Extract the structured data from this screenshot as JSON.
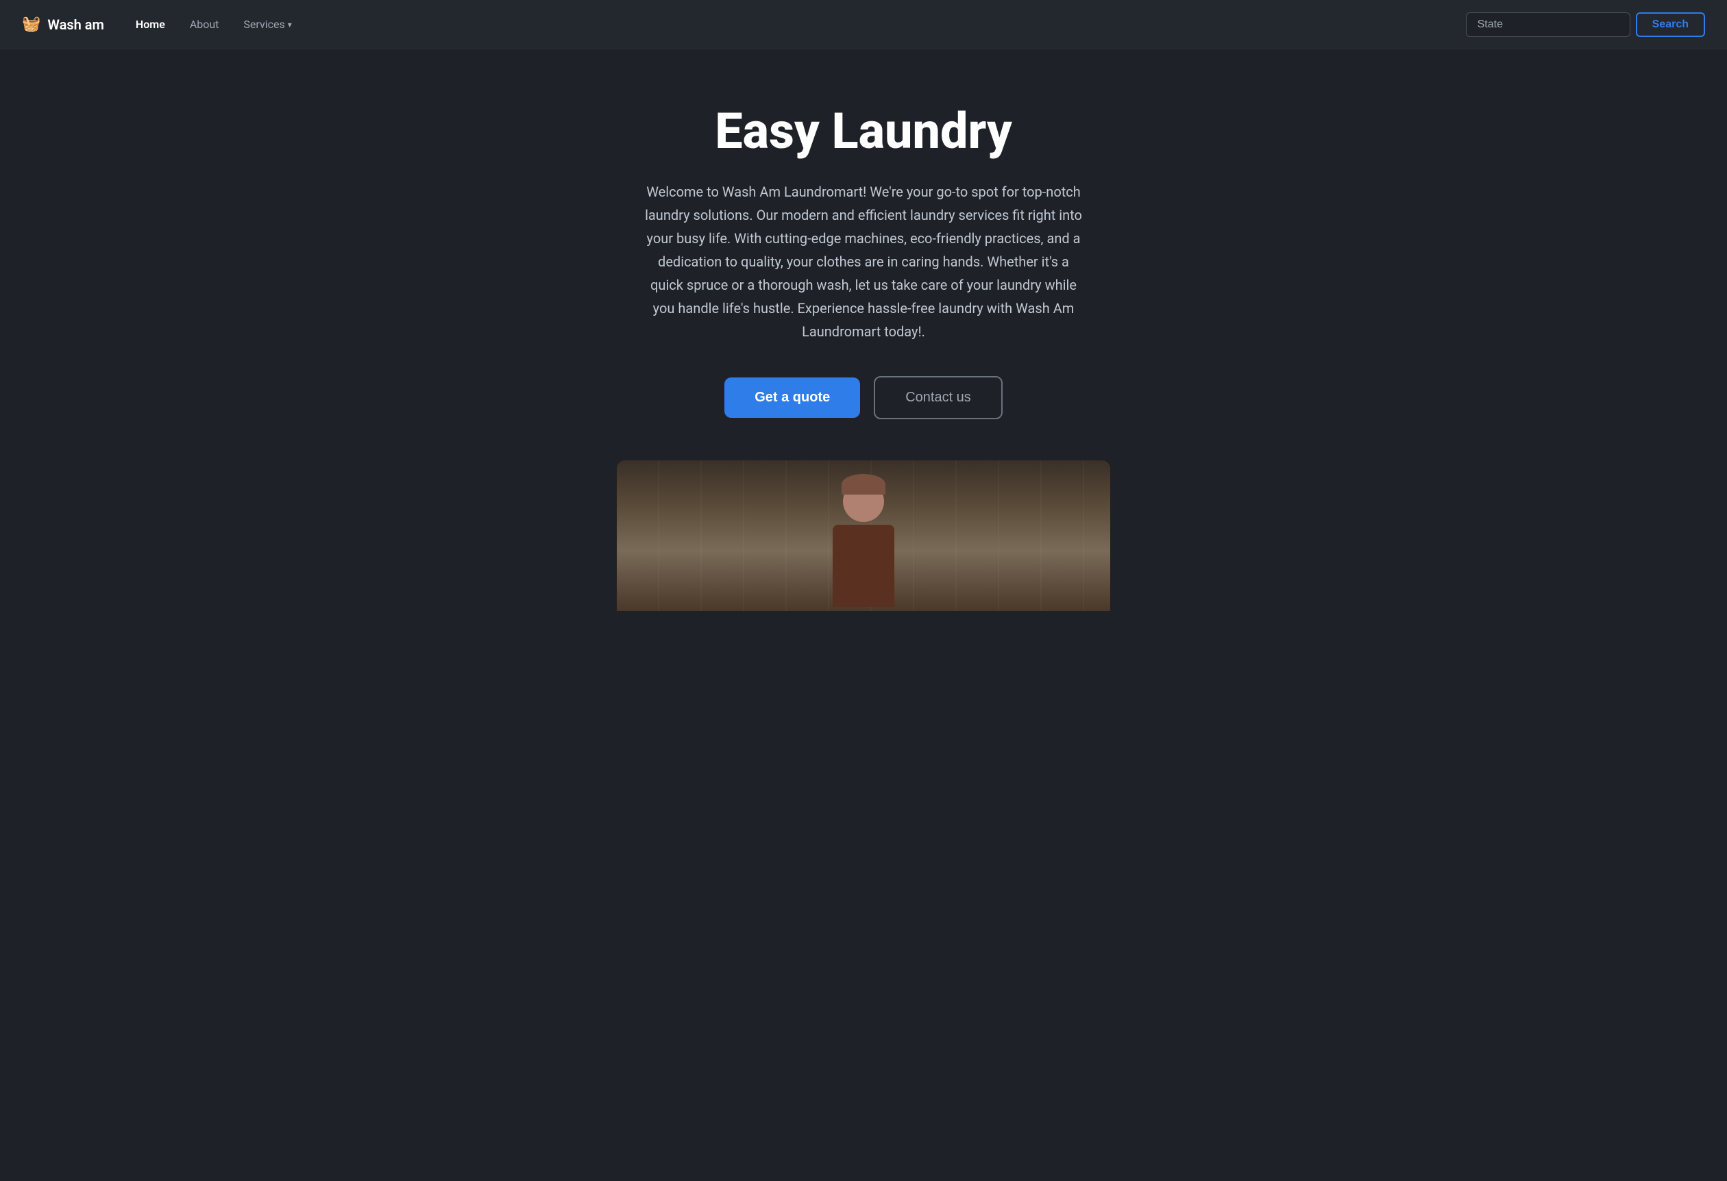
{
  "nav": {
    "brand_icon": "🧺",
    "brand_name": "Wash am",
    "links": [
      {
        "label": "Home",
        "active": true
      },
      {
        "label": "About",
        "active": false
      },
      {
        "label": "Services",
        "has_dropdown": true,
        "active": false
      }
    ],
    "search": {
      "placeholder": "State",
      "button_label": "Search"
    }
  },
  "hero": {
    "title": "Easy Laundry",
    "description": "Welcome to Wash Am Laundromart! We're your go-to spot for top-notch laundry solutions. Our modern and efficient laundry services fit right into your busy life. With cutting-edge machines, eco-friendly practices, and a dedication to quality, your clothes are in caring hands. Whether it's a quick spruce or a thorough wash, let us take care of your laundry while you handle life's hustle. Experience hassle-free laundry with Wash Am Laundromart today!.",
    "cta_primary": "Get a quote",
    "cta_secondary": "Contact us"
  }
}
